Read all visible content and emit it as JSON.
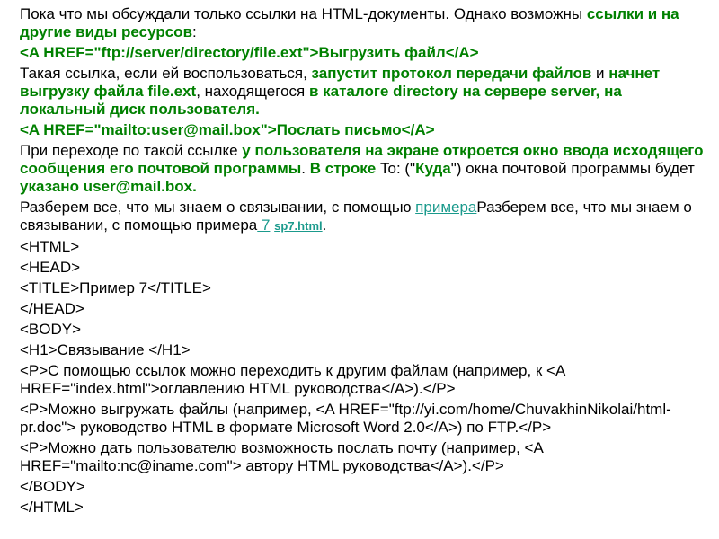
{
  "p1": {
    "t1": "Пока что мы обсуждали только ссылки на HTML-документы. Однако возможны ",
    "g1": "ссылки и на другие виды ресурсов",
    "t2": ":"
  },
  "code1": "<A HREF=\"ftp://server/directory/file.ext\">Выгрузить файл</A>",
  "p2": {
    "t1": "Такая ссылка, если ей воспользоваться, ",
    "g1": "запустит протокол передачи файлов",
    "t2": " и ",
    "g2": "начнет выгрузку файла file.ext",
    "t3": ", находящегося ",
    "g3": "в каталоге directory на сервере server, на локальный диск пользователя."
  },
  "code2": "<A HREF=\"mailto:user@mail.box\">Послать письмо</A>",
  "p3": {
    "t1": "При переходе по такой ссылке ",
    "g1": "у пользователя на экране откроется окно ввода исходящего сообщения его почтовой программы",
    "t2": ". ",
    "g2": "В строке",
    "t3": " To: (\"",
    "g3": "Куда",
    "t4": "\") окна почтовой программы будет ",
    "g4": "указано user@mail.box."
  },
  "p4": {
    "t1": "Разберем все, что мы знаем о связывании, с помощью ",
    "link1": "примера",
    "t2": "Разберем все, что мы знаем о связывании, с помощью примера",
    "link2": " 7",
    "t3": " ",
    "link3": "sp7.html",
    "t4": "."
  },
  "code_lines": [
    "<HTML>",
    "<HEAD>",
    "<TITLE>Пример 7</TITLE>",
    "</HEAD>",
    "<BODY>",
    "<H1>Связывание </H1>",
    "<P>С помощью ссылок можно переходить к другим файлам (например, к <A HREF=\"index.html\">оглавлению HTML руководства</A>).</P>",
    "<P>Можно выгружать файлы (например, <A HREF=\"ftp://yi.com/home/ChuvakhinNikolai/html-pr.doc\"> руководство HTML в формате Microsoft Word 2.0</A>) по FTP.</P>",
    "<P>Можно дать пользователю возможность послать почту (например, <A HREF=\"mailto:nc@iname.com\"> автору HTML руководства</A>).</P>",
    "</BODY>",
    "</HTML>"
  ],
  "colors": {
    "highlight": "#008000",
    "link": "#1a9a8c"
  }
}
